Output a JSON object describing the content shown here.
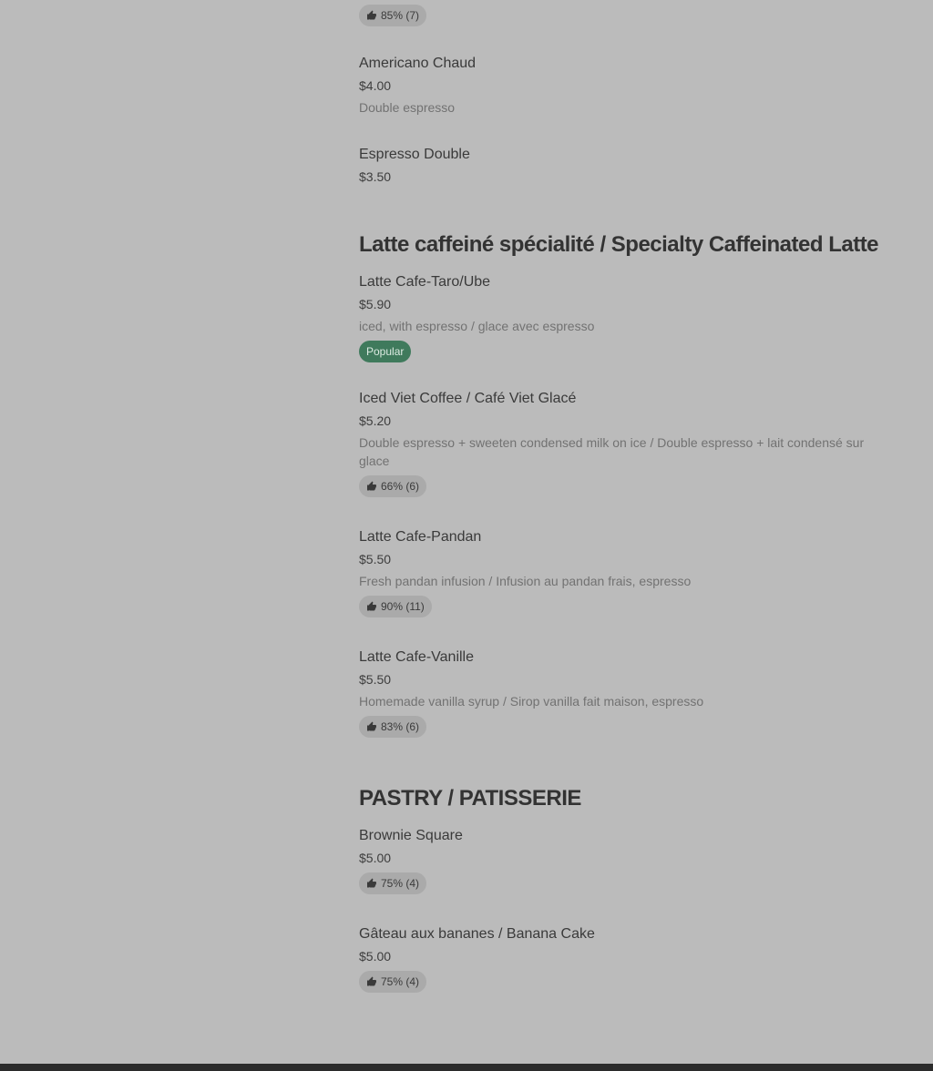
{
  "top_rating": "85% (7)",
  "sections": [
    {
      "items": [
        {
          "name": "Americano Chaud",
          "price": "$4.00",
          "description": "Double espresso"
        },
        {
          "name": "Espresso Double",
          "price": "$3.50"
        }
      ]
    },
    {
      "title": "Latte caffeiné spécialité / Specialty Caffeinated Latte",
      "items": [
        {
          "name": "Latte Cafe-Taro/Ube",
          "price": "$5.90",
          "description": "iced, with espresso / glace avec espresso",
          "tag": "Popular"
        },
        {
          "name": "Iced Viet Coffee / Café Viet Glacé",
          "price": "$5.20",
          "description": "Double espresso + sweeten condensed milk on ice / Double espresso + lait condensé sur glace",
          "rating": "66% (6)"
        },
        {
          "name": "Latte Cafe-Pandan",
          "price": "$5.50",
          "description": "Fresh pandan infusion / Infusion au pandan frais, espresso",
          "rating": "90% (11)"
        },
        {
          "name": "Latte Cafe-Vanille",
          "price": "$5.50",
          "description": "Homemade vanilla syrup / Sirop vanilla fait maison, espresso",
          "rating": "83% (6)"
        }
      ]
    },
    {
      "title": "PASTRY / PATISSERIE",
      "items": [
        {
          "name": "Brownie Square",
          "price": "$5.00",
          "rating": "75% (4)"
        },
        {
          "name": "Gâteau aux bananes / Banana Cake",
          "price": "$5.00",
          "rating": "75% (4)"
        }
      ]
    }
  ],
  "colors": {
    "background": "#bbbbbb",
    "rating_badge": "#aaaaaa",
    "popular_badge": "#3f7a5c",
    "footer_bar": "#2b2b2b"
  },
  "icons": {
    "rating": "thumbs-up-icon"
  }
}
